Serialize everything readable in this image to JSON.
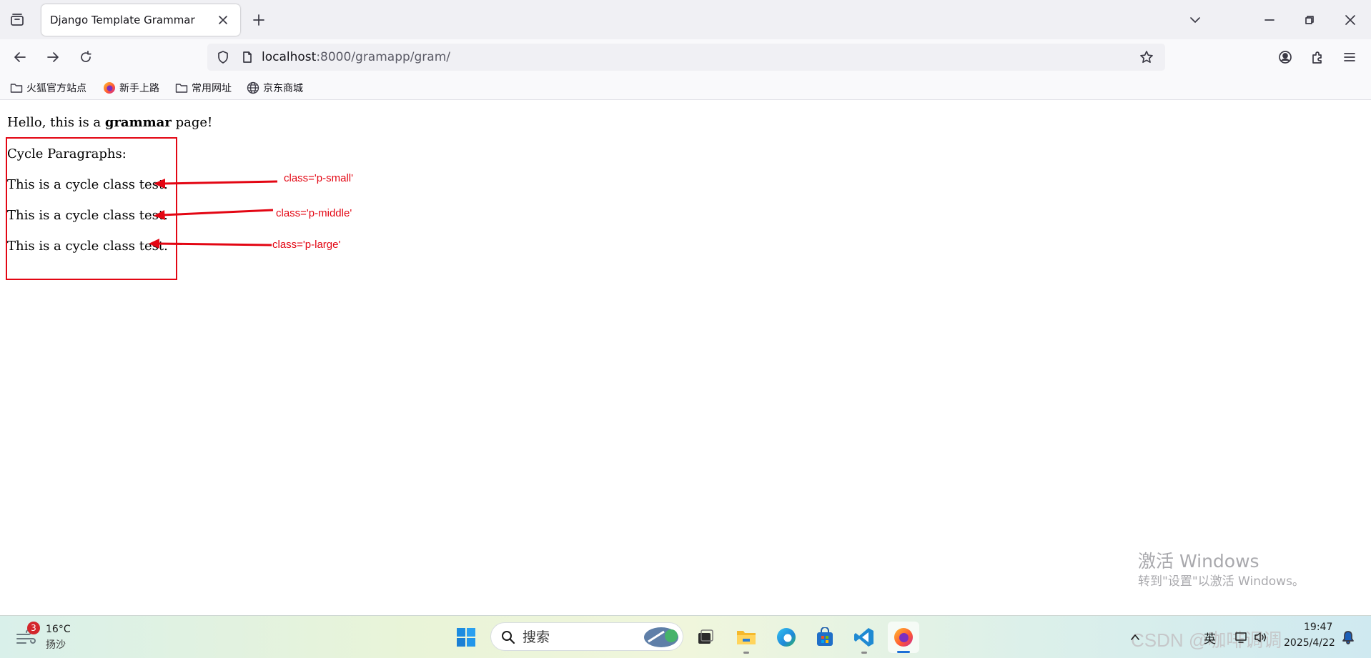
{
  "browser": {
    "tab": {
      "title": "Django Template Grammar"
    },
    "url": {
      "host": "localhost",
      "rest": ":8000/gramapp/gram/"
    },
    "bookmarks": [
      {
        "label": "火狐官方站点",
        "icon": "folder-icon"
      },
      {
        "label": "新手上路",
        "icon": "firefox-icon"
      },
      {
        "label": "常用网址",
        "icon": "folder-icon"
      },
      {
        "label": "京东商城",
        "icon": "globe-icon"
      }
    ]
  },
  "page": {
    "hello": {
      "prefix": "Hello, this is a ",
      "bold": "grammar",
      "suffix": " page!"
    },
    "cycle_heading": "Cycle Paragraphs:",
    "paragraphs": [
      "This is a cycle class test.",
      "This is a cycle class test.",
      "This is a cycle class test."
    ],
    "annotations": [
      "class='p-small'",
      "class='p-middle'",
      "class='p-large'"
    ],
    "annotation_color": "#e30613"
  },
  "watermark": {
    "line1": "激活 Windows",
    "line2": "转到\"设置\"以激活 Windows。"
  },
  "taskbar": {
    "weather": {
      "badge": "3",
      "temp": "16°C",
      "desc": "扬沙"
    },
    "search_placeholder": "搜索",
    "tray": {
      "csdn": "CSDN @咖啡调调",
      "ime": "英",
      "time": "19:47",
      "date": "2025/4/22"
    }
  }
}
